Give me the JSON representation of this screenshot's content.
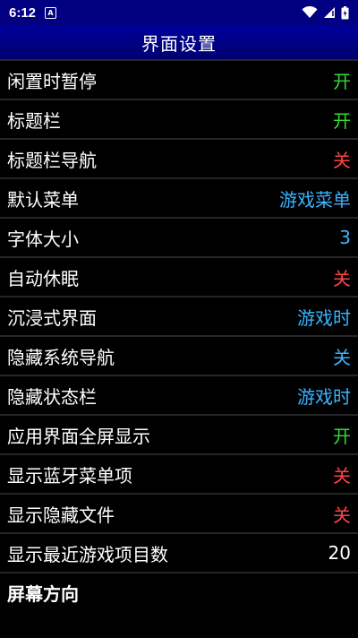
{
  "status_bar": {
    "time": "6:12",
    "notification_icon_letter": "A",
    "icons": [
      "wifi-icon",
      "signal-icon",
      "battery-icon"
    ]
  },
  "title_bar": {
    "title": "界面设置"
  },
  "colors": {
    "on": "#33dd33",
    "off": "#ff4444",
    "option": "#3ab4ff",
    "neutral": "#ffffff",
    "title_bg": "#000080",
    "divider": "#262626"
  },
  "settings": [
    {
      "label": "闲置时暂停",
      "value": "开"
    },
    {
      "label": "标题栏",
      "value": "开"
    },
    {
      "label": "标题栏导航",
      "value": "关"
    },
    {
      "label": "默认菜单",
      "value": "游戏菜单"
    },
    {
      "label": "字体大小",
      "value": "3"
    },
    {
      "label": "自动休眠",
      "value": "关"
    },
    {
      "label": "沉浸式界面",
      "value": "游戏时"
    },
    {
      "label": "隐藏系统导航",
      "value": "关"
    },
    {
      "label": "隐藏状态栏",
      "value": "游戏时"
    },
    {
      "label": "应用界面全屏显示",
      "value": "开"
    },
    {
      "label": "显示蓝牙菜单项",
      "value": "关"
    },
    {
      "label": "显示隐藏文件",
      "value": "关"
    },
    {
      "label": "显示最近游戏项目数",
      "value": "20"
    }
  ],
  "section_header": {
    "label": "屏幕方向"
  }
}
